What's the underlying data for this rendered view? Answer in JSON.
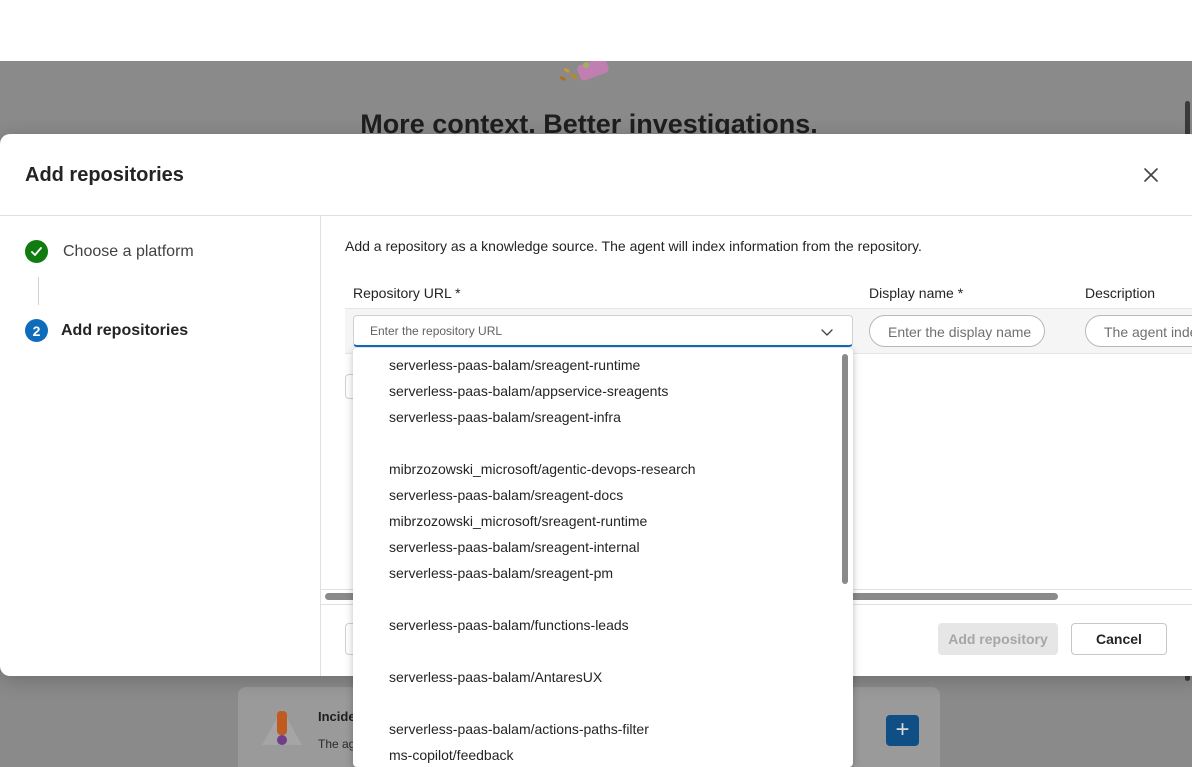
{
  "background": {
    "hero_title": "More context. Better investigations.",
    "card_title": "Incide",
    "card_desc": "The ag",
    "card_plus": "+"
  },
  "dialog": {
    "title": "Add repositories",
    "steps": [
      {
        "label": "Choose a platform",
        "state": "done"
      },
      {
        "number": "2",
        "label": "Add repositories",
        "state": "active"
      }
    ],
    "intro": "Add a repository as a knowledge source. The agent will index information from the repository.",
    "columns": {
      "url": "Repository URL *",
      "display_name": "Display name *",
      "description": "Description"
    },
    "inputs": {
      "url_placeholder": "Enter the repository URL",
      "display_name_placeholder": "Enter the display name",
      "description_placeholder": "The agent indexes"
    },
    "add_button": "Add repository",
    "cancel_button": "Cancel"
  },
  "dropdown_options": [
    "serverless-paas-balam/sreagent-runtime",
    "serverless-paas-balam/appservice-sreagents",
    "serverless-paas-balam/sreagent-infra",
    "mibrzozowski_microsoft/agentic-devops-research",
    "serverless-paas-balam/sreagent-docs",
    "mibrzozowski_microsoft/sreagent-runtime",
    "serverless-paas-balam/sreagent-internal",
    "serverless-paas-balam/sreagent-pm",
    "serverless-paas-balam/functions-leads",
    "serverless-paas-balam/AntaresUX",
    "serverless-paas-balam/actions-paths-filter",
    "ms-copilot/feedback"
  ],
  "colors": {
    "accent": "#0f6cbd",
    "success": "#107c10"
  }
}
